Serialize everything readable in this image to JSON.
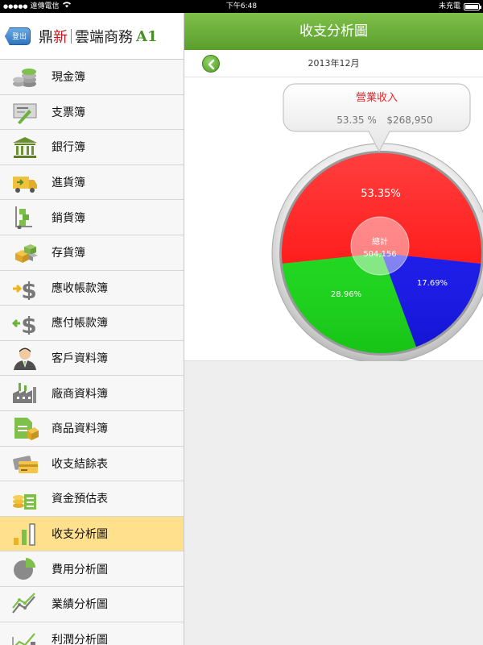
{
  "status_bar": {
    "carrier": "遠傳電信",
    "time": "下午6:48",
    "battery_text": "未充電"
  },
  "sidebar": {
    "logout_label": "登出",
    "brand": {
      "part1": "鼎",
      "part2": "新",
      "part3": "雲端商務",
      "version": "A1"
    },
    "items": [
      {
        "label": "現金簿",
        "icon": "coins-icon",
        "active": false
      },
      {
        "label": "支票簿",
        "icon": "check-pen-icon",
        "active": false
      },
      {
        "label": "銀行簿",
        "icon": "bank-icon",
        "active": false
      },
      {
        "label": "進貨簿",
        "icon": "delivery-truck-icon",
        "active": false
      },
      {
        "label": "銷貨簿",
        "icon": "hand-truck-icon",
        "active": false
      },
      {
        "label": "存貨簿",
        "icon": "boxes-icon",
        "active": false
      },
      {
        "label": "應收帳款簿",
        "icon": "dollar-in-icon",
        "active": false
      },
      {
        "label": "應付帳款簿",
        "icon": "dollar-out-icon",
        "active": false
      },
      {
        "label": "客戶資料簿",
        "icon": "customer-icon",
        "active": false
      },
      {
        "label": "廠商資料簿",
        "icon": "factory-icon",
        "active": false
      },
      {
        "label": "商品資料簿",
        "icon": "product-doc-icon",
        "active": false
      },
      {
        "label": "收支結餘表",
        "icon": "card-icon",
        "active": false
      },
      {
        "label": "資金預估表",
        "icon": "fund-doc-icon",
        "active": false
      },
      {
        "label": "收支分析圖",
        "icon": "bar-chart-icon",
        "active": true
      },
      {
        "label": "費用分析圖",
        "icon": "pie-icon",
        "active": false
      },
      {
        "label": "業績分析圖",
        "icon": "line-chart-icon",
        "active": false
      },
      {
        "label": "利潤分析圖",
        "icon": "profit-chart-icon",
        "active": false
      }
    ]
  },
  "main": {
    "title": "收支分析圖",
    "date": "2013年12月"
  },
  "colors": {
    "accent_green": "#6cb23a",
    "active_row": "#ffe08c",
    "slice_red": "#ff1414",
    "slice_blue": "#1414e6",
    "slice_green": "#18d418"
  },
  "chart_data": {
    "type": "pie",
    "tooltip": {
      "title": "營業收入",
      "percent_text": "53.35 %",
      "amount_text": "$268,950"
    },
    "center": {
      "label": "總計",
      "value_text": "504,156"
    },
    "slices": [
      {
        "percent": 53.35,
        "label": "53.35%",
        "color": "#ff1414"
      },
      {
        "percent": 17.69,
        "label": "17.69%",
        "color": "#1414e6"
      },
      {
        "percent": 28.96,
        "label": "28.96%",
        "color": "#18d418"
      }
    ]
  }
}
